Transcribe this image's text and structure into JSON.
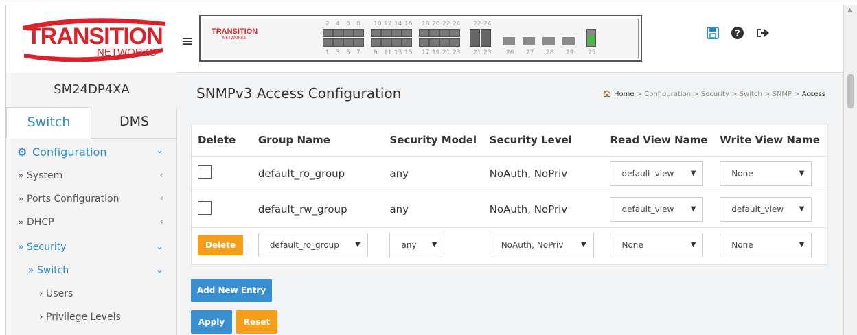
{
  "app": {
    "logo_text_top": "TRANSITION",
    "logo_text_bottom": "NETWORKS",
    "device_name": "SM24DP4XA"
  },
  "sidebar": {
    "tabs": [
      {
        "label": "Switch",
        "active": true
      },
      {
        "label": "DMS",
        "active": false
      }
    ],
    "items": [
      {
        "label": "Configuration",
        "chevron": "⌄",
        "active": true
      },
      {
        "label": "» System",
        "chevron": "‹",
        "active": false
      },
      {
        "label": "» Ports Configuration",
        "chevron": "‹",
        "active": false
      },
      {
        "label": "» DHCP",
        "chevron": "‹",
        "active": false
      },
      {
        "label": "» Security",
        "chevron": "⌄",
        "active": true
      },
      {
        "label": "» Switch",
        "chevron": "⌄",
        "active": true
      },
      {
        "label": "› Users",
        "chevron": "",
        "active": false
      },
      {
        "label": "› Privilege Levels",
        "chevron": "",
        "active": false
      }
    ]
  },
  "topbar": {
    "panel_logo": "TRANSITION",
    "panel_logo_sub": "NETWORKS",
    "ports_top": [
      "2",
      "4",
      "6",
      "8",
      "10",
      "12",
      "14",
      "16",
      "18",
      "20",
      "22",
      "24",
      "22",
      "24"
    ],
    "ports_bottom": [
      "1",
      "3",
      "5",
      "7",
      "9",
      "11",
      "13",
      "15",
      "17",
      "19",
      "21",
      "23",
      "21",
      "23",
      "26",
      "27",
      "28",
      "29",
      "25"
    ],
    "icons": [
      "save-icon",
      "help-icon",
      "logout-icon"
    ]
  },
  "main": {
    "title": "SNMPv3 Access Configuration",
    "breadcrumb": [
      "Home",
      ">",
      "Configuration",
      ">",
      "Security",
      ">",
      "Switch",
      ">",
      "SNMP",
      ">",
      "Access"
    ],
    "columns": [
      "Delete",
      "Group Name",
      "Security Model",
      "Security Level",
      "Read View Name",
      "Write View Name"
    ],
    "rows": [
      {
        "group": "default_ro_group",
        "model": "any",
        "level": "NoAuth, NoPriv",
        "read": "default_view",
        "write": "None"
      },
      {
        "group": "default_rw_group",
        "model": "any",
        "level": "NoAuth, NoPriv",
        "read": "default_view",
        "write": "default_view"
      }
    ],
    "new_row": {
      "delete_label": "Delete",
      "group": "default_ro_group",
      "model": "any",
      "level": "NoAuth, NoPriv",
      "read": "None",
      "write": "None"
    },
    "buttons": {
      "add_new_entry": "Add New Entry",
      "apply": "Apply",
      "reset": "Reset"
    }
  },
  "colors": {
    "accent": "#2d8ccc",
    "logo_red": "#d8232a",
    "orange_button": "#f49e1c",
    "blue_button": "#3a8fd0"
  }
}
